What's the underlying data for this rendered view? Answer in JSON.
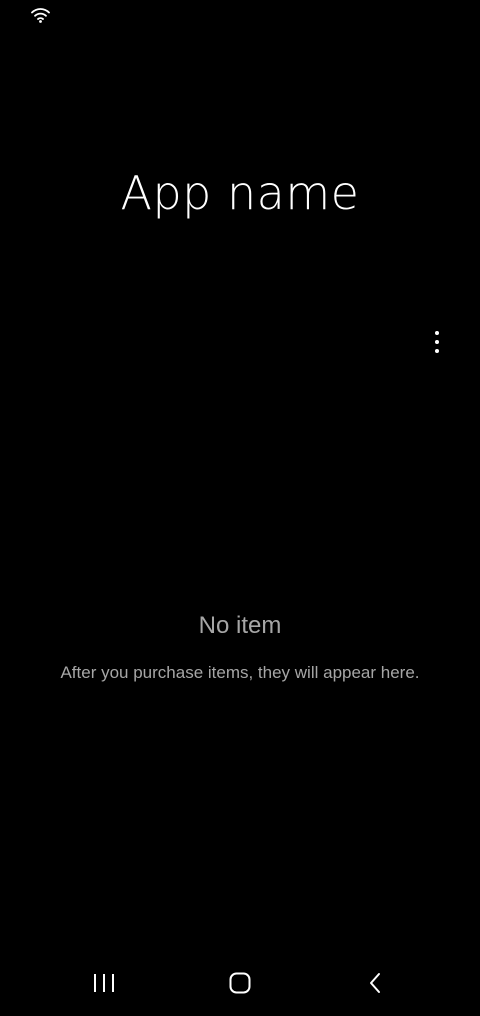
{
  "app": {
    "title": "App name"
  },
  "empty_state": {
    "title": "No item",
    "description": "After you purchase items, they will appear here."
  },
  "icons": {
    "status_wifi": "wifi-icon",
    "overflow_menu": "more-vert-icon",
    "nav_recents": "recents-icon",
    "nav_home": "home-icon",
    "nav_back": "back-icon"
  },
  "colors": {
    "background": "#000000",
    "title_text": "#ffffff",
    "secondary_text": "#a6a6a6"
  }
}
